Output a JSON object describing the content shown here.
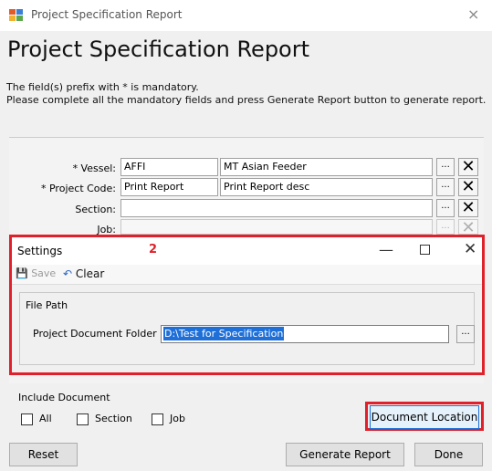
{
  "window": {
    "title": "Project Specification Report",
    "close": "×"
  },
  "heading": "Project Specification Report",
  "instructions": {
    "line1": "The field(s) prefix with * is mandatory.",
    "line2": "Please complete all the mandatory fields and press Generate Report button to generate report."
  },
  "fields": {
    "vessel": {
      "label": "* Vessel:",
      "code": "AFFI",
      "desc": "MT Asian Feeder"
    },
    "project_code": {
      "label": "* Project Code:",
      "code": "Print Report",
      "desc": "Print Report desc"
    },
    "section": {
      "label": "Section:",
      "code": "",
      "desc": ""
    },
    "job": {
      "label": "Job:",
      "code": "",
      "desc": ""
    }
  },
  "buttons": {
    "ellipsis": "...",
    "clear_x": "✕"
  },
  "settings_dialog": {
    "title": "Settings",
    "annotation": "2",
    "minimize": "—",
    "close": "✕",
    "save_label": "Save",
    "clear_label": "Clear",
    "group_title": "File Path",
    "doc_folder_label": "Project Document Folder :",
    "doc_folder_value": "D:\\Test for Specification",
    "browse": "..."
  },
  "include_document": {
    "title": "Include Document",
    "options": [
      {
        "label": "All",
        "checked": false
      },
      {
        "label": "Section",
        "checked": false
      },
      {
        "label": "Job",
        "checked": false
      }
    ]
  },
  "bottom_buttons": {
    "document_location": "Document Location",
    "reset": "Reset",
    "generate_report": "Generate Report",
    "done": "Done"
  },
  "colors": {
    "annotation_red": "#e0202a",
    "selection_blue": "#1e6fd8"
  }
}
